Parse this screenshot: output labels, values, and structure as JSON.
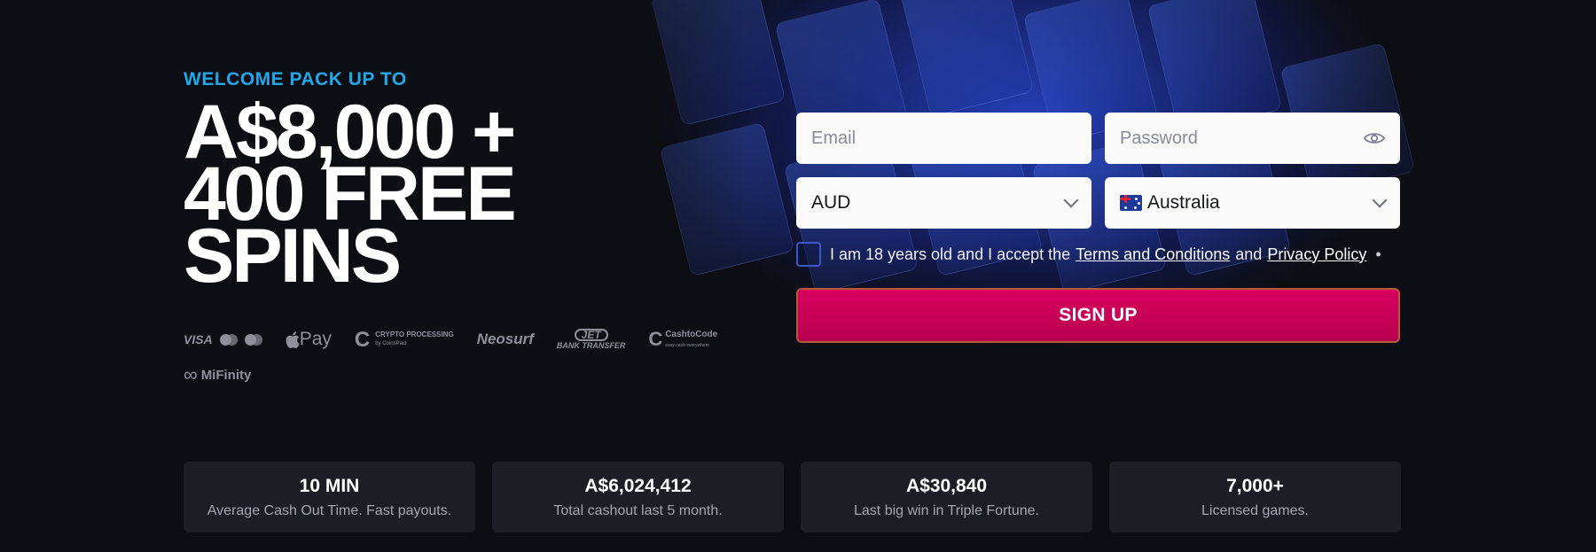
{
  "hero": {
    "welcome": "WELCOME PACK UP TO",
    "line1": "A$8,000 +",
    "line2": "400 FREE",
    "line3": "SPINS"
  },
  "payments": {
    "visa": "VISA",
    "apple_pay": "Pay",
    "crypto": "CRYPTO PROCESSING",
    "crypto_sub": "by CoinsPaid",
    "neosurf": "Neosurf",
    "jet": "JET",
    "jet_sub": "BANK TRANSFER",
    "cashtocode": "CashtoCode",
    "cashtocode_sub": "easy cash everywhere",
    "mifinity": "MiFinity"
  },
  "form": {
    "email_placeholder": "Email",
    "password_placeholder": "Password",
    "currency": "AUD",
    "country": "Australia",
    "terms_prefix": "I am 18 years old and I accept the",
    "terms_link": "Terms and Conditions",
    "terms_and": "and",
    "privacy_link": "Privacy Policy",
    "required_mark": "•",
    "signup_label": "SIGN UP"
  },
  "stats": [
    {
      "value": "10 MIN",
      "label": "Average Cash Out Time. Fast payouts."
    },
    {
      "value": "A$6,024,412",
      "label": "Total cashout last 5 month."
    },
    {
      "value": "A$30,840",
      "label": "Last big win in Triple Fortune."
    },
    {
      "value": "7,000+",
      "label": "Licensed games."
    }
  ],
  "colors": {
    "accent_blue": "#22a8e8",
    "signup": "#d8005f",
    "background": "#0d0e14",
    "card": "#1d1e25"
  }
}
